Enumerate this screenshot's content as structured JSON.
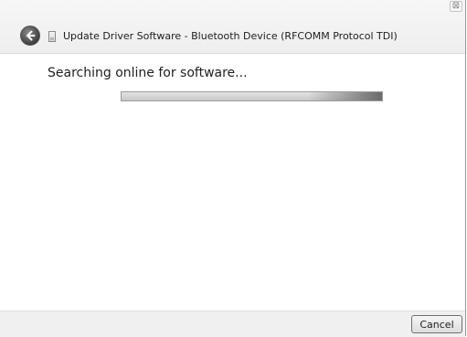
{
  "window": {
    "title": "Update Driver Software - Bluetooth Device (RFCOMM Protocol TDI)",
    "close_glyph": "⊠"
  },
  "main": {
    "status": "Searching online for software...",
    "progress_fraction": 1.0
  },
  "footer": {
    "cancel_label": "Cancel"
  },
  "icons": {
    "back": "back-arrow-icon",
    "driver": "driver-device-icon",
    "close": "close-icon"
  }
}
